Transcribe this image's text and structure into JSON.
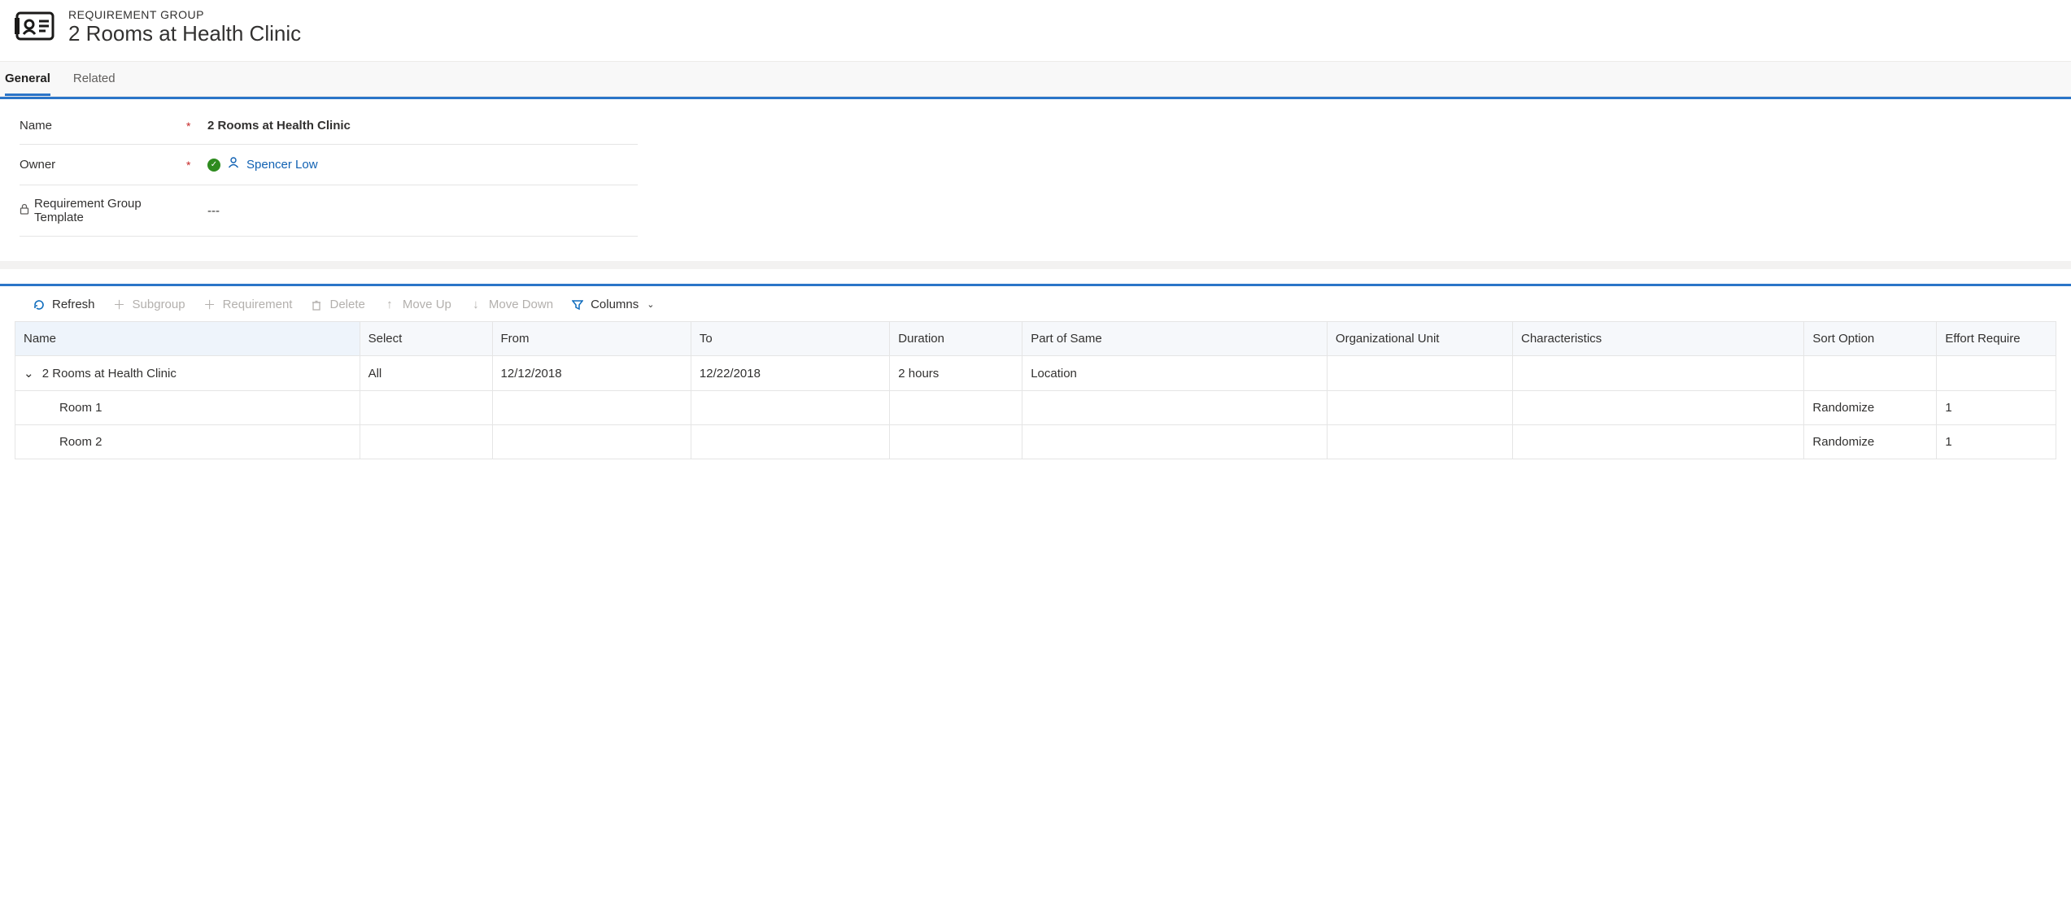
{
  "header": {
    "eyebrow": "REQUIREMENT GROUP",
    "title": "2 Rooms at Health Clinic"
  },
  "tabs": {
    "general": "General",
    "related": "Related"
  },
  "form": {
    "name_label": "Name",
    "name_value": "2 Rooms at Health Clinic",
    "owner_label": "Owner",
    "owner_value": "Spencer Low",
    "template_label": "Requirement Group Template",
    "template_value": "---"
  },
  "toolbar": {
    "refresh": "Refresh",
    "subgroup": "Subgroup",
    "requirement": "Requirement",
    "delete": "Delete",
    "moveup": "Move Up",
    "movedown": "Move Down",
    "columns": "Columns"
  },
  "grid": {
    "headers": {
      "name": "Name",
      "select": "Select",
      "from": "From",
      "to": "To",
      "duration": "Duration",
      "partofsame": "Part of Same",
      "orgunit": "Organizational Unit",
      "characteristics": "Characteristics",
      "sortoption": "Sort Option",
      "effort": "Effort Require"
    },
    "rows": [
      {
        "name": "2 Rooms at Health Clinic",
        "select": "All",
        "from": "12/12/2018",
        "to": "12/22/2018",
        "duration": "2 hours",
        "partofsame": "Location",
        "orgunit": "",
        "characteristics": "",
        "sortoption": "",
        "effort": ""
      },
      {
        "name": "Room 1",
        "select": "",
        "from": "",
        "to": "",
        "duration": "",
        "partofsame": "",
        "orgunit": "",
        "characteristics": "",
        "sortoption": "Randomize",
        "effort": "1"
      },
      {
        "name": "Room 2",
        "select": "",
        "from": "",
        "to": "",
        "duration": "",
        "partofsame": "",
        "orgunit": "",
        "characteristics": "",
        "sortoption": "Randomize",
        "effort": "1"
      }
    ]
  }
}
